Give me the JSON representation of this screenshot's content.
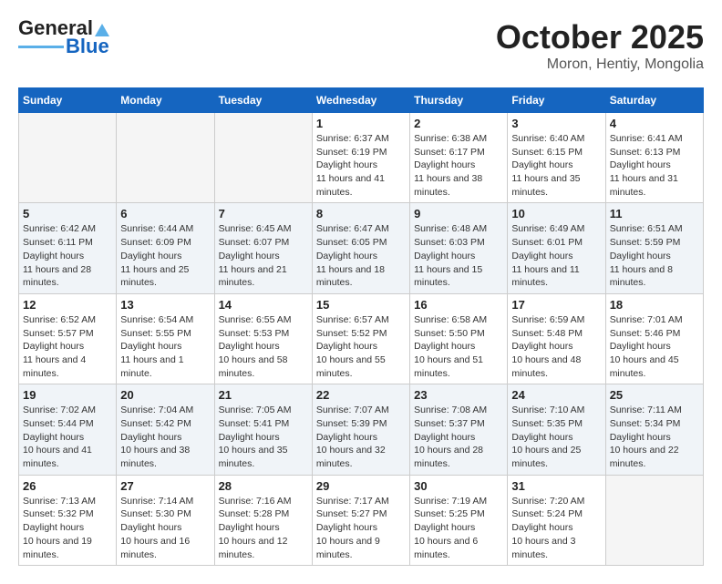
{
  "header": {
    "logo_line1": "General",
    "logo_line2": "Blue",
    "month": "October 2025",
    "location": "Moron, Hentiy, Mongolia"
  },
  "weekdays": [
    "Sunday",
    "Monday",
    "Tuesday",
    "Wednesday",
    "Thursday",
    "Friday",
    "Saturday"
  ],
  "weeks": [
    [
      {
        "day": "",
        "empty": true
      },
      {
        "day": "",
        "empty": true
      },
      {
        "day": "",
        "empty": true
      },
      {
        "day": "1",
        "sunrise": "6:37 AM",
        "sunset": "6:19 PM",
        "daylight": "11 hours and 41 minutes."
      },
      {
        "day": "2",
        "sunrise": "6:38 AM",
        "sunset": "6:17 PM",
        "daylight": "11 hours and 38 minutes."
      },
      {
        "day": "3",
        "sunrise": "6:40 AM",
        "sunset": "6:15 PM",
        "daylight": "11 hours and 35 minutes."
      },
      {
        "day": "4",
        "sunrise": "6:41 AM",
        "sunset": "6:13 PM",
        "daylight": "11 hours and 31 minutes."
      }
    ],
    [
      {
        "day": "5",
        "sunrise": "6:42 AM",
        "sunset": "6:11 PM",
        "daylight": "11 hours and 28 minutes."
      },
      {
        "day": "6",
        "sunrise": "6:44 AM",
        "sunset": "6:09 PM",
        "daylight": "11 hours and 25 minutes."
      },
      {
        "day": "7",
        "sunrise": "6:45 AM",
        "sunset": "6:07 PM",
        "daylight": "11 hours and 21 minutes."
      },
      {
        "day": "8",
        "sunrise": "6:47 AM",
        "sunset": "6:05 PM",
        "daylight": "11 hours and 18 minutes."
      },
      {
        "day": "9",
        "sunrise": "6:48 AM",
        "sunset": "6:03 PM",
        "daylight": "11 hours and 15 minutes."
      },
      {
        "day": "10",
        "sunrise": "6:49 AM",
        "sunset": "6:01 PM",
        "daylight": "11 hours and 11 minutes."
      },
      {
        "day": "11",
        "sunrise": "6:51 AM",
        "sunset": "5:59 PM",
        "daylight": "11 hours and 8 minutes."
      }
    ],
    [
      {
        "day": "12",
        "sunrise": "6:52 AM",
        "sunset": "5:57 PM",
        "daylight": "11 hours and 4 minutes."
      },
      {
        "day": "13",
        "sunrise": "6:54 AM",
        "sunset": "5:55 PM",
        "daylight": "11 hours and 1 minute."
      },
      {
        "day": "14",
        "sunrise": "6:55 AM",
        "sunset": "5:53 PM",
        "daylight": "10 hours and 58 minutes."
      },
      {
        "day": "15",
        "sunrise": "6:57 AM",
        "sunset": "5:52 PM",
        "daylight": "10 hours and 55 minutes."
      },
      {
        "day": "16",
        "sunrise": "6:58 AM",
        "sunset": "5:50 PM",
        "daylight": "10 hours and 51 minutes."
      },
      {
        "day": "17",
        "sunrise": "6:59 AM",
        "sunset": "5:48 PM",
        "daylight": "10 hours and 48 minutes."
      },
      {
        "day": "18",
        "sunrise": "7:01 AM",
        "sunset": "5:46 PM",
        "daylight": "10 hours and 45 minutes."
      }
    ],
    [
      {
        "day": "19",
        "sunrise": "7:02 AM",
        "sunset": "5:44 PM",
        "daylight": "10 hours and 41 minutes."
      },
      {
        "day": "20",
        "sunrise": "7:04 AM",
        "sunset": "5:42 PM",
        "daylight": "10 hours and 38 minutes."
      },
      {
        "day": "21",
        "sunrise": "7:05 AM",
        "sunset": "5:41 PM",
        "daylight": "10 hours and 35 minutes."
      },
      {
        "day": "22",
        "sunrise": "7:07 AM",
        "sunset": "5:39 PM",
        "daylight": "10 hours and 32 minutes."
      },
      {
        "day": "23",
        "sunrise": "7:08 AM",
        "sunset": "5:37 PM",
        "daylight": "10 hours and 28 minutes."
      },
      {
        "day": "24",
        "sunrise": "7:10 AM",
        "sunset": "5:35 PM",
        "daylight": "10 hours and 25 minutes."
      },
      {
        "day": "25",
        "sunrise": "7:11 AM",
        "sunset": "5:34 PM",
        "daylight": "10 hours and 22 minutes."
      }
    ],
    [
      {
        "day": "26",
        "sunrise": "7:13 AM",
        "sunset": "5:32 PM",
        "daylight": "10 hours and 19 minutes."
      },
      {
        "day": "27",
        "sunrise": "7:14 AM",
        "sunset": "5:30 PM",
        "daylight": "10 hours and 16 minutes."
      },
      {
        "day": "28",
        "sunrise": "7:16 AM",
        "sunset": "5:28 PM",
        "daylight": "10 hours and 12 minutes."
      },
      {
        "day": "29",
        "sunrise": "7:17 AM",
        "sunset": "5:27 PM",
        "daylight": "10 hours and 9 minutes."
      },
      {
        "day": "30",
        "sunrise": "7:19 AM",
        "sunset": "5:25 PM",
        "daylight": "10 hours and 6 minutes."
      },
      {
        "day": "31",
        "sunrise": "7:20 AM",
        "sunset": "5:24 PM",
        "daylight": "10 hours and 3 minutes."
      },
      {
        "day": "",
        "empty": true
      }
    ]
  ],
  "labels": {
    "sunrise_prefix": "Sunrise: ",
    "sunset_prefix": "Sunset: ",
    "daylight_label": "Daylight hours"
  }
}
